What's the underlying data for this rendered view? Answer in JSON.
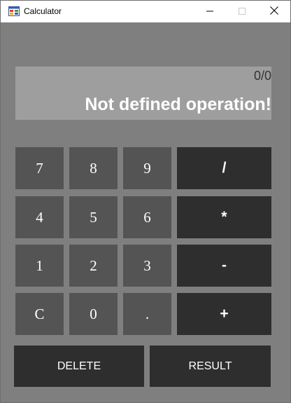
{
  "window": {
    "title": "Calculator",
    "icon": "calculator-app-icon",
    "controls": {
      "minimize": "minimize-icon",
      "maximize": "maximize-icon",
      "close": "close-icon"
    }
  },
  "display": {
    "expression": "0/0",
    "result": "Not defined operation!"
  },
  "keypad": {
    "digits": {
      "seven": "7",
      "eight": "8",
      "nine": "9",
      "four": "4",
      "five": "5",
      "six": "6",
      "one": "1",
      "two": "2",
      "three": "3",
      "clear": "C",
      "zero": "0",
      "decimal": "."
    },
    "operators": {
      "divide": "/",
      "multiply": "*",
      "subtract": "-",
      "add": "+"
    }
  },
  "actions": {
    "delete": "DELETE",
    "result": "RESULT"
  },
  "colors": {
    "window_bg": "#7f7f7f",
    "display_bg": "#9e9e9e",
    "digit_key_bg": "#545454",
    "operator_key_bg": "#2e2e2e",
    "text": "#ffffff"
  }
}
